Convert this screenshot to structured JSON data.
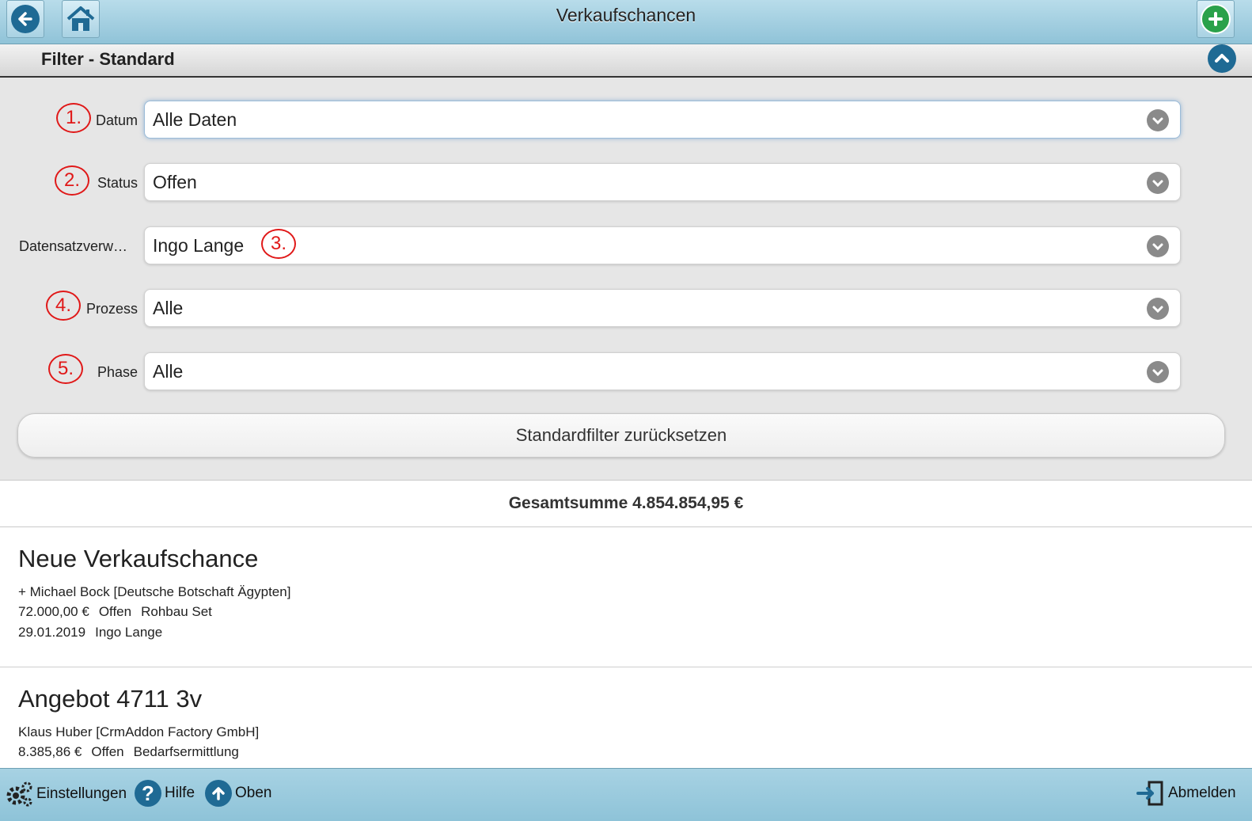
{
  "header": {
    "title": "Verkaufschancen",
    "icons": [
      "back-arrow-icon",
      "home-icon",
      "plus-icon"
    ]
  },
  "filter": {
    "title": "Filter - Standard",
    "rows": [
      {
        "label": "Datum",
        "value": "Alle Daten",
        "marker": "1."
      },
      {
        "label": "Status",
        "value": "Offen",
        "marker": "2."
      },
      {
        "label": "Datensatzverw…",
        "value": "Ingo Lange",
        "marker": "3."
      },
      {
        "label": "Prozess",
        "value": "Alle",
        "marker": "4."
      },
      {
        "label": "Phase",
        "value": "Alle",
        "marker": "5."
      }
    ],
    "reset_label": "Standardfilter zurücksetzen"
  },
  "list": {
    "total": "Gesamtsumme 4.854.854,95 €",
    "items": [
      {
        "title": "Neue Verkaufschance",
        "contact": "+ Michael Bock [Deutsche Botschaft Ägypten]",
        "amount": "72.000,00 €",
        "status": "Offen",
        "phase": "Rohbau Set",
        "date": "29.01.2019",
        "owner": "Ingo Lange"
      },
      {
        "title": "Angebot 4711 3v",
        "contact": "Klaus Huber [CrmAddon Factory GmbH]",
        "amount": "8.385,86 €",
        "status": "Offen",
        "phase": "Bedarfsermittlung"
      }
    ]
  },
  "footer": {
    "settings": "Einstellungen",
    "help": "Hilfe",
    "top": "Oben",
    "logout": "Abmelden"
  }
}
